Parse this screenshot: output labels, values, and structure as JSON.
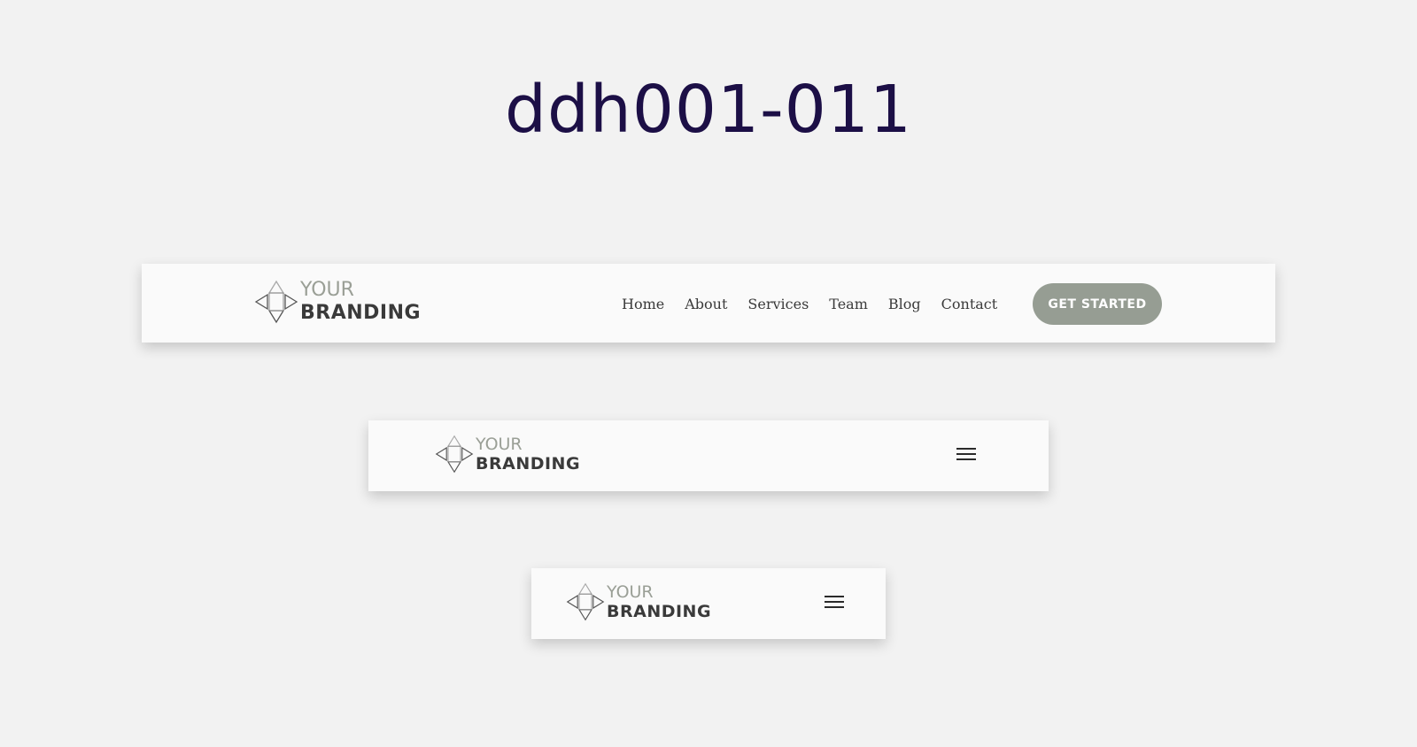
{
  "page": {
    "title": "ddh001-011"
  },
  "brand": {
    "line1": "YOUR",
    "line2": "BRANDING"
  },
  "nav": {
    "items": [
      {
        "label": "Home"
      },
      {
        "label": "About"
      },
      {
        "label": "Services"
      },
      {
        "label": "Team"
      },
      {
        "label": "Blog"
      },
      {
        "label": "Contact"
      }
    ]
  },
  "cta": {
    "label": "GET STARTED"
  },
  "icons": {
    "logo": "diamond-arrows-logo-icon",
    "menu": "hamburger-menu-icon"
  },
  "colors": {
    "background": "#f2f2f2",
    "header_bg": "#fafafa",
    "title": "#1c0f46",
    "accent": "#969d93",
    "text": "#3a3a3a"
  }
}
